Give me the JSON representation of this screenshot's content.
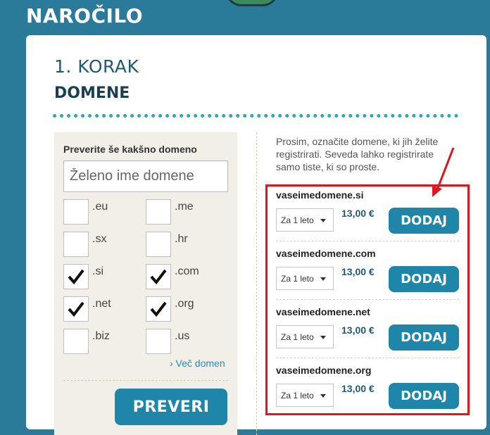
{
  "header": {
    "title": "NAROČILO"
  },
  "step": {
    "label": "1. KORAK",
    "name": "DOMENE"
  },
  "check_panel": {
    "title": "Preverite še kakšno domeno",
    "input_placeholder": "Želeno ime domene",
    "tlds": [
      {
        "label": ".eu",
        "checked": false
      },
      {
        "label": ".me",
        "checked": false
      },
      {
        "label": ".sx",
        "checked": false
      },
      {
        "label": ".hr",
        "checked": false
      },
      {
        "label": ".si",
        "checked": true
      },
      {
        "label": ".com",
        "checked": true
      },
      {
        "label": ".net",
        "checked": true
      },
      {
        "label": ".org",
        "checked": true
      },
      {
        "label": ".biz",
        "checked": false
      },
      {
        "label": ".us",
        "checked": false
      }
    ],
    "more_link": "› Več domen",
    "check_button": "PREVERI"
  },
  "results": {
    "instruction": "Prosim, označite domene, ki jih želite registrirati. Seveda lahko registrirate samo tiste, ki so proste.",
    "items": [
      {
        "domain": "vaseimedomene.si",
        "period": "Za 1 leto",
        "price": "13,00 €",
        "button": "DODAJ"
      },
      {
        "domain": "vaseimedomene.com",
        "period": "Za 1 leto",
        "price": "13,00 €",
        "button": "DODAJ"
      },
      {
        "domain": "vaseimedomene.net",
        "period": "Za 1 leto",
        "price": "13,00 €",
        "button": "DODAJ"
      },
      {
        "domain": "vaseimedomene.org",
        "period": "Za 1 leto",
        "price": "13,00 €",
        "button": "DODAJ"
      }
    ]
  },
  "colors": {
    "background": "#2a7a99",
    "accent": "#1e86a8",
    "highlight": "#e3141b"
  }
}
